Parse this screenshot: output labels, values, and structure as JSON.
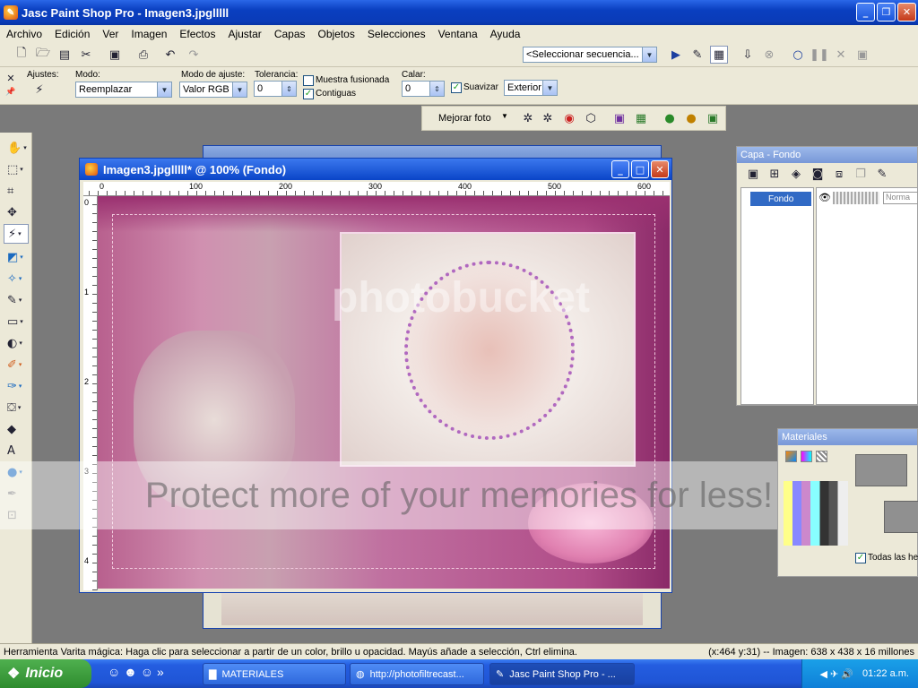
{
  "app": {
    "title": "Jasc Paint Shop Pro - Imagen3.jpglllll"
  },
  "menu": [
    "Archivo",
    "Edición",
    "Ver",
    "Imagen",
    "Efectos",
    "Ajustar",
    "Capas",
    "Objetos",
    "Selecciones",
    "Ventana",
    "Ayuda"
  ],
  "toolbar": {
    "script_select": "<Seleccionar secuencia..."
  },
  "tool_options": {
    "ajustes_label": "Ajustes:",
    "modo_label": "Modo:",
    "modo_value": "Reemplazar",
    "modo_ajuste_label": "Modo de ajuste:",
    "modo_ajuste_value": "Valor RGB",
    "tolerancia_label": "Tolerancia:",
    "tolerancia_value": "0",
    "muestra_fusionada": "Muestra fusionada",
    "contiguas": "Contiguas",
    "calar_label": "Calar:",
    "calar_value": "0",
    "suavizar": "Suavizar",
    "suavizar_mode": "Exterior"
  },
  "photo_bar": {
    "mejorar_foto": "Mejorar foto"
  },
  "ruler": {
    "h_labels": [
      "0",
      "100",
      "200",
      "300",
      "400",
      "500",
      "600"
    ],
    "v_labels": [
      "0",
      "1",
      "2",
      "3",
      "4"
    ]
  },
  "image_window": {
    "title": "Imagen3.jpglllll* @ 100% (Fondo)"
  },
  "layers_panel": {
    "title": "Capa - Fondo",
    "layer_name": "Fondo",
    "blend_mode": "Norma"
  },
  "materials_panel": {
    "title": "Materiales",
    "all_tools": "Todas las her"
  },
  "watermark": {
    "text": "Protect more of your memories for less!",
    "logo": "photobucket"
  },
  "status": {
    "left": "Herramienta Varita mágica: Haga clic para seleccionar a partir de un color, brillo u opacidad. Mayús añade a selección, Ctrl elimina.",
    "right": "(x:464 y:31) -- Imagen:  638 x 438 x 16 millones"
  },
  "taskbar": {
    "start": "Inicio",
    "items": [
      "MATERIALES",
      "http://photofiltrecast...",
      "Jasc Paint Shop Pro - ..."
    ],
    "clock": "01:22 a.m."
  },
  "colors": {
    "titlebar": "#0a45c8",
    "chrome": "#ece9d8",
    "workspace": "#7a7a7a",
    "taskbar": "#245de0",
    "start": "#3a9a3a",
    "pink": "#c04a8e"
  }
}
